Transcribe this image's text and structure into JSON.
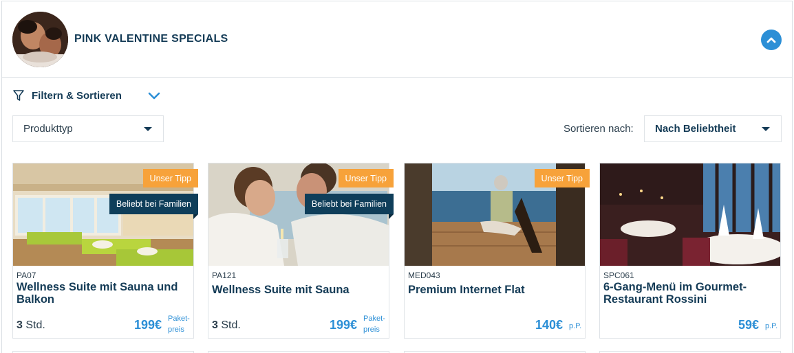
{
  "header": {
    "title": "PINK VALENTINE SPECIALS"
  },
  "filter": {
    "label": "Filtern & Sortieren",
    "product_type_value": "Produkttyp",
    "sort_label": "Sortieren nach:",
    "sort_value": "Nach Beliebtheit"
  },
  "cards": [
    {
      "code": "PA07",
      "name": "Wellness Suite mit Sauna und Balkon",
      "duration_value": "3",
      "duration_unit": " Std.",
      "price": "199€",
      "price_note_1": "Paket-",
      "price_note_2": "preis",
      "badge_tipp": "Unser Tipp",
      "badge_family": "Beliebt bei Familien"
    },
    {
      "code": "PA121",
      "name": "Wellness Suite mit Sauna",
      "duration_value": "3",
      "duration_unit": " Std.",
      "price": "199€",
      "price_note_1": "Paket-",
      "price_note_2": "preis",
      "badge_tipp": "Unser Tipp",
      "badge_family": "Beliebt bei Familien"
    },
    {
      "code": "MED043",
      "name": "Premium Internet Flat",
      "price": "140€",
      "price_note_1": "p.P.",
      "badge_tipp": "Unser Tipp"
    },
    {
      "code": "SPC061",
      "name": "6-Gang-Menü im Gourmet-Restaurant Rossini",
      "price": "59€",
      "price_note_1": "p.P."
    }
  ],
  "colors": {
    "accent": "#2c8fd6",
    "navy": "#143b56",
    "badge_orange": "#f7a23a",
    "badge_navy": "#0f3e5a"
  },
  "icons": {
    "collapse": "chevron-up-icon",
    "filter": "funnel-icon",
    "filter_toggle": "chevron-down-icon"
  }
}
